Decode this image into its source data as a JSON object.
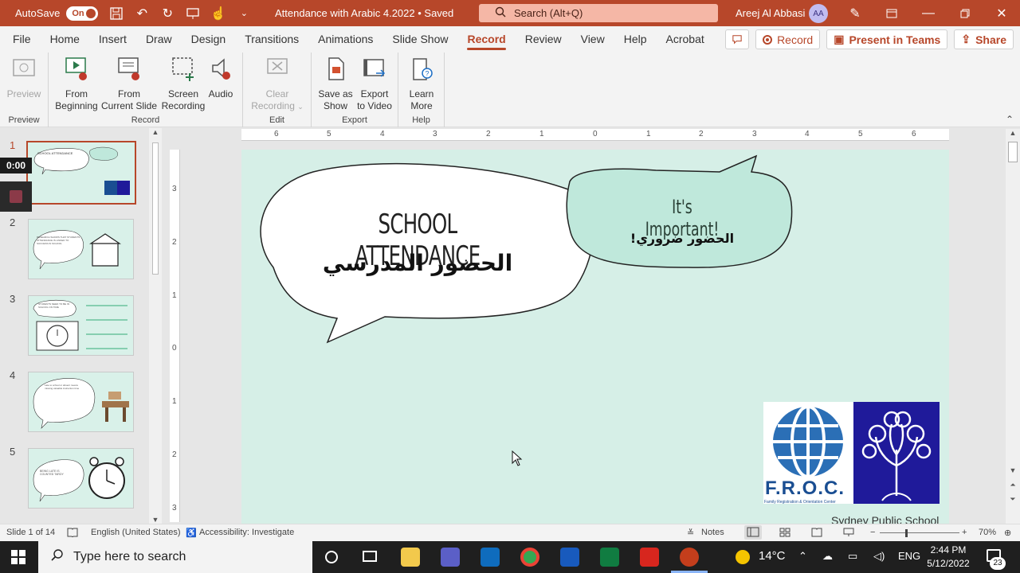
{
  "titlebar": {
    "autosave_label": "AutoSave",
    "autosave_state": "On",
    "document_title": "Attendance with Arabic 4.2022 • Saved",
    "search_placeholder": "Search (Alt+Q)",
    "user_name": "Areej Al Abbasi",
    "user_initials": "AA",
    "accent": "#b7472a"
  },
  "tabs": [
    "File",
    "Home",
    "Insert",
    "Draw",
    "Design",
    "Transitions",
    "Animations",
    "Slide Show",
    "Record",
    "Review",
    "View",
    "Help",
    "Acrobat"
  ],
  "active_tab": "Record",
  "tab_actions": {
    "record": "Record",
    "present_in_teams": "Present in Teams",
    "share": "Share"
  },
  "ribbon": {
    "preview_group": {
      "label": "Preview",
      "preview": "Preview"
    },
    "record_group": {
      "label": "Record",
      "from_beginning_1": "From",
      "from_beginning_2": "Beginning",
      "from_current_1": "From",
      "from_current_2": "Current Slide",
      "screen_rec_1": "Screen",
      "screen_rec_2": "Recording",
      "audio": "Audio"
    },
    "edit_group": {
      "label": "Edit",
      "clear_1": "Clear",
      "clear_2": "Recording"
    },
    "export_group": {
      "label": "Export",
      "save_show_1": "Save as",
      "save_show_2": "Show",
      "export_video_1": "Export",
      "export_video_2": "to Video"
    },
    "help_group": {
      "label": "Help",
      "learn_1": "Learn",
      "learn_2": "More"
    }
  },
  "recording": {
    "timer": "0:00"
  },
  "thumbnails": [
    {
      "num": "1",
      "text": "SCHOOL ATTENDANCE"
    },
    {
      "num": "2",
      "text": "RESEARCH SHOWS THAT STUDENTS ATTENDANCE IS LINKED TO SUCCESS IN SCHOOL"
    },
    {
      "num": "3",
      "text": "STUDENTS NEED TO BE IN SCHOOL ON TIME"
    },
    {
      "num": "4",
      "text": "Late to school or absent means missing valuable instruction time"
    },
    {
      "num": "5",
      "text": "BEING LATE IS COUNTED TARDY"
    }
  ],
  "ruler_h": [
    "6",
    "5",
    "4",
    "3",
    "2",
    "1",
    "0",
    "1",
    "2",
    "3",
    "4",
    "5",
    "6"
  ],
  "ruler_v": [
    "3",
    "2",
    "1",
    "0",
    "1",
    "2",
    "3"
  ],
  "slide": {
    "title_en": "SCHOOL ATTENDANCE",
    "title_ar": "الحضور المدرسي",
    "bubble_en": "It's Important!",
    "bubble_ar": "الحضور ضروري!",
    "logo_text": "F.R.O.C.",
    "logo_sub": "Family Registration & Orientation Center",
    "footer_text": "Sydney Public School",
    "bg": "#d6efe7",
    "bubble_bg": "#bfe8db"
  },
  "statusbar": {
    "slide_info": "Slide 1 of 14",
    "language": "English (United States)",
    "accessibility": "Accessibility: Investigate",
    "notes": "Notes",
    "zoom": "70%"
  },
  "taskbar": {
    "search_placeholder": "Type here to search",
    "weather": "14°C",
    "lang": "ENG",
    "time": "2:44 PM",
    "date": "5/12/2022",
    "notifications": "23"
  }
}
